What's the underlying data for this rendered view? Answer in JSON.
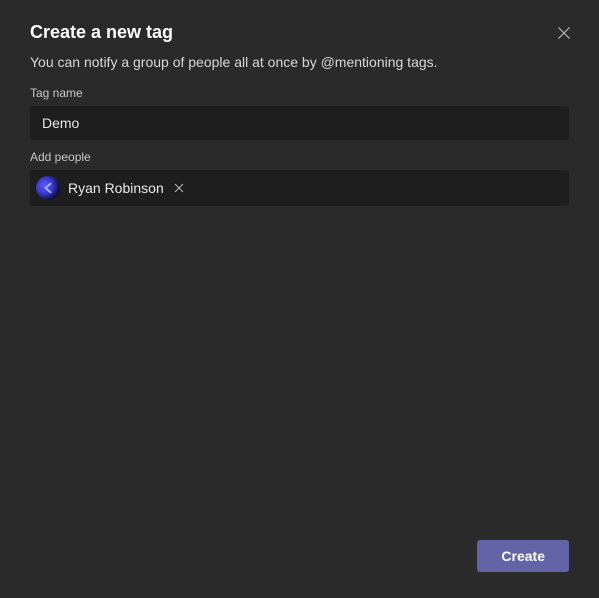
{
  "dialog": {
    "title": "Create a new tag",
    "subtitle": "You can notify a group of people all at once by @mentioning tags."
  },
  "fields": {
    "tagName": {
      "label": "Tag name",
      "value": "Demo"
    },
    "addPeople": {
      "label": "Add people",
      "people": [
        {
          "name": "Ryan Robinson"
        }
      ]
    }
  },
  "actions": {
    "create": "Create"
  }
}
